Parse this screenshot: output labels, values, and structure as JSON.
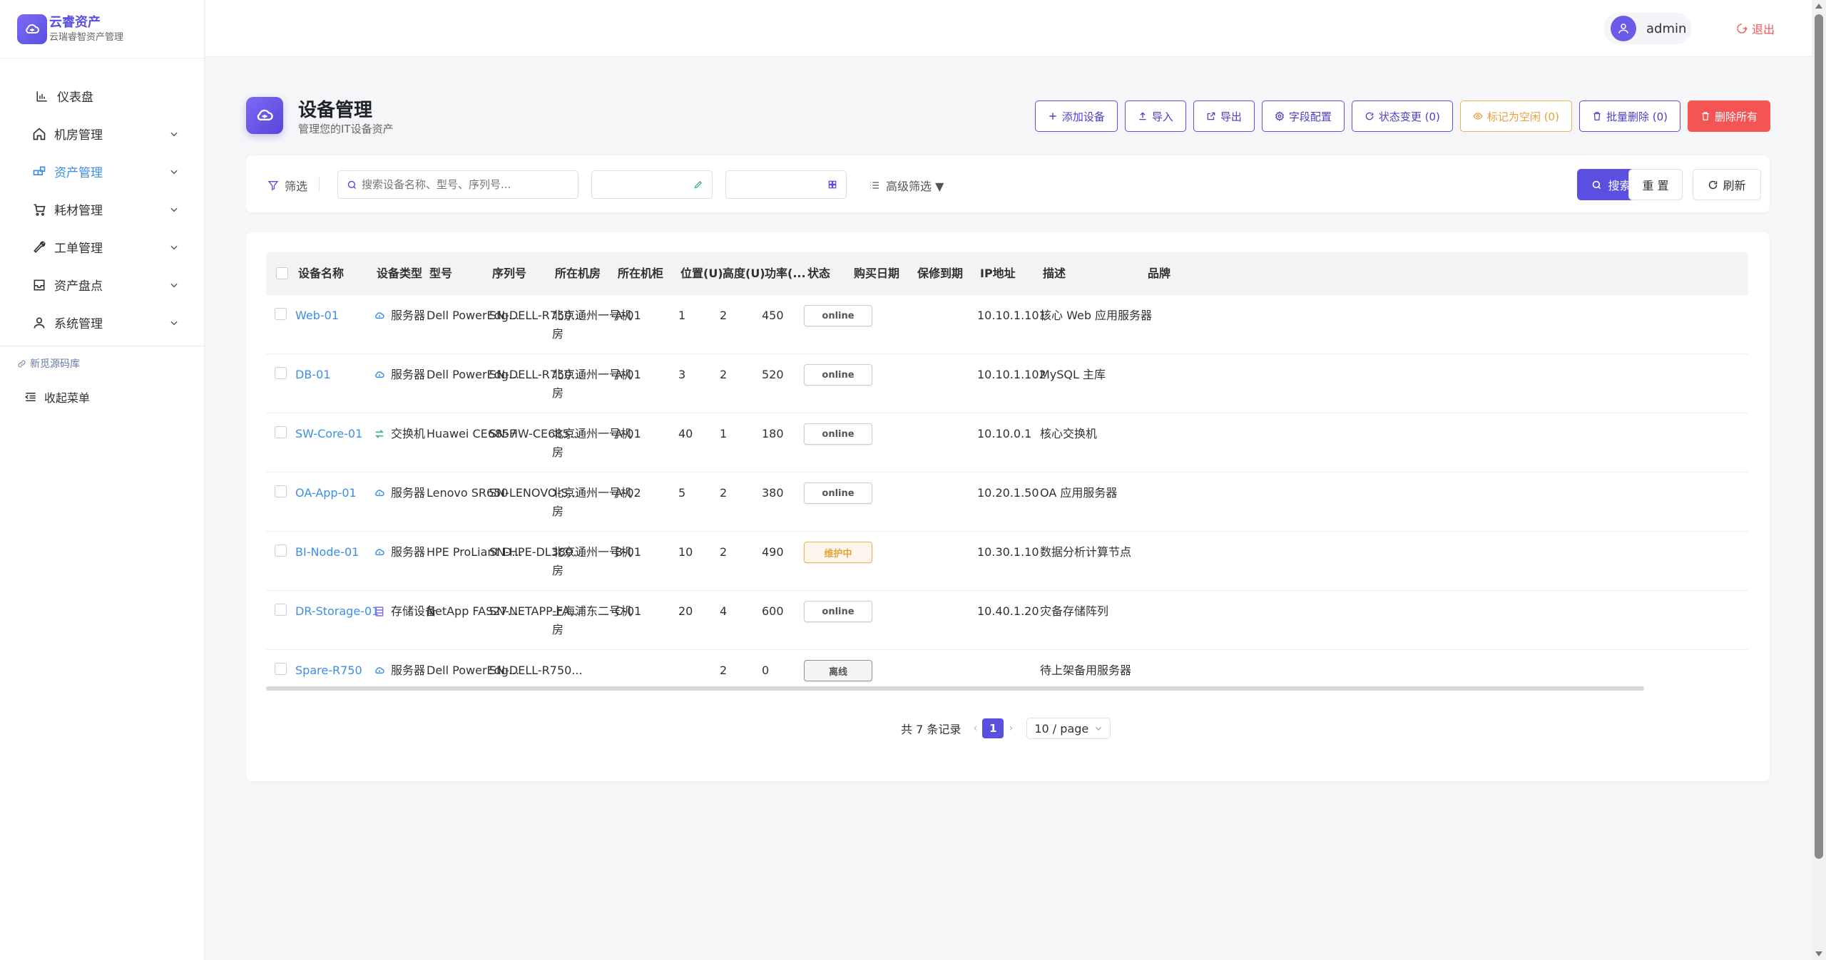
{
  "app": {
    "title": "云睿资产",
    "subtitle": "云瑞睿智资产管理"
  },
  "sidebar": {
    "items": [
      {
        "label": "仪表盘",
        "icon": "bar-chart-icon",
        "chevron": false,
        "active": false
      },
      {
        "label": "机房管理",
        "icon": "home-icon",
        "chevron": true,
        "active": false
      },
      {
        "label": "资产管理",
        "icon": "assets-icon",
        "chevron": true,
        "active": true
      },
      {
        "label": "耗材管理",
        "icon": "cart-icon",
        "chevron": true,
        "active": false
      },
      {
        "label": "工单管理",
        "icon": "wrench-icon",
        "chevron": true,
        "active": false
      },
      {
        "label": "资产盘点",
        "icon": "inbox-icon",
        "chevron": true,
        "active": false
      },
      {
        "label": "系统管理",
        "icon": "user-icon",
        "chevron": true,
        "active": false
      }
    ],
    "link_label": "新觅源码库",
    "collapse_label": "收起菜单"
  },
  "header": {
    "username": "admin",
    "logout_label": "退出"
  },
  "page": {
    "title": "设备管理",
    "subtitle": "管理您的IT设备资产"
  },
  "actions": {
    "add": "添加设备",
    "import": "导入",
    "export": "导出",
    "fields": "字段配置",
    "status_change": "状态变更 (0)",
    "mark_idle": "标记为空闲 (0)",
    "batch_delete": "批量删除 (0)",
    "delete_all": "删除所有"
  },
  "filter": {
    "label": "筛选",
    "search_placeholder": "搜索设备名称、型号、序列号...",
    "advanced": "高级筛选 ▼",
    "search_btn": "搜索",
    "reset_btn": "重 置",
    "refresh_btn": "刷新"
  },
  "table": {
    "columns": [
      "设备名称",
      "设备类型",
      "型号",
      "序列号",
      "所在机房",
      "所在机柜",
      "位置(U)",
      "高度(U)",
      "功率(...",
      "状态",
      "购买日期",
      "保修到期",
      "IP地址",
      "描述",
      "品牌"
    ],
    "rows": [
      {
        "name": "Web-01",
        "type": "服务器",
        "type_icon": "cloud-icon",
        "model": "Dell PowerEdg...",
        "serial": "SN-DELL-R750...",
        "room": "北京通州一号机房",
        "rack": "A-01",
        "pos": "1",
        "height": "2",
        "power": "450",
        "status": "online",
        "status_kind": "online",
        "buy": "",
        "warranty": "",
        "ip": "10.10.1.101",
        "desc": "核心 Web 应用服务器",
        "brand": ""
      },
      {
        "name": "DB-01",
        "type": "服务器",
        "type_icon": "cloud-icon",
        "model": "Dell PowerEdg...",
        "serial": "SN-DELL-R750...",
        "room": "北京通州一号机房",
        "rack": "A-01",
        "pos": "3",
        "height": "2",
        "power": "520",
        "status": "online",
        "status_kind": "online",
        "buy": "",
        "warranty": "",
        "ip": "10.10.1.102",
        "desc": "MySQL 主库",
        "brand": ""
      },
      {
        "name": "SW-Core-01",
        "type": "交换机",
        "type_icon": "switch-icon",
        "model": "Huawei CE6857",
        "serial": "SN-HW-CE685...",
        "room": "北京通州一号机房",
        "rack": "A-01",
        "pos": "40",
        "height": "1",
        "power": "180",
        "status": "online",
        "status_kind": "online",
        "buy": "",
        "warranty": "",
        "ip": "10.10.0.1",
        "desc": "核心交换机",
        "brand": ""
      },
      {
        "name": "OA-App-01",
        "type": "服务器",
        "type_icon": "cloud-icon",
        "model": "Lenovo SR650",
        "serial": "SN-LENOVO-S...",
        "room": "北京通州一号机房",
        "rack": "A-02",
        "pos": "5",
        "height": "2",
        "power": "380",
        "status": "online",
        "status_kind": "online",
        "buy": "",
        "warranty": "",
        "ip": "10.20.1.50",
        "desc": "OA 应用服务器",
        "brand": ""
      },
      {
        "name": "BI-Node-01",
        "type": "服务器",
        "type_icon": "cloud-icon",
        "model": "HPE ProLiant D...",
        "serial": "SN-HPE-DL380...",
        "room": "北京通州一号机房",
        "rack": "B-01",
        "pos": "10",
        "height": "2",
        "power": "490",
        "status": "维护中",
        "status_kind": "maint",
        "buy": "",
        "warranty": "",
        "ip": "10.30.1.10",
        "desc": "数据分析计算节点",
        "brand": ""
      },
      {
        "name": "DR-Storage-01",
        "type": "存储设备",
        "type_icon": "storage-icon",
        "model": "NetApp FAS27...",
        "serial": "SN-NETAPP-FA...",
        "room": "上海浦东二号机房",
        "rack": "C-01",
        "pos": "20",
        "height": "4",
        "power": "600",
        "status": "online",
        "status_kind": "online",
        "buy": "",
        "warranty": "",
        "ip": "10.40.1.20",
        "desc": "灾备存储阵列",
        "brand": ""
      },
      {
        "name": "Spare-R750",
        "type": "服务器",
        "type_icon": "cloud-icon",
        "model": "Dell PowerEdg...",
        "serial": "SN-DELL-R750...",
        "room": "",
        "rack": "",
        "pos": "",
        "height": "2",
        "power": "0",
        "status": "离线",
        "status_kind": "off",
        "buy": "",
        "warranty": "",
        "ip": "",
        "desc": "待上架备用服务器",
        "brand": ""
      }
    ]
  },
  "pagination": {
    "total": "共 7 条记录",
    "current": "1",
    "page_size": "10 / page"
  },
  "colors": {
    "accent": "#5a4fe0",
    "link": "#3a8ee6",
    "danger": "#f45454",
    "warning": "#e5a13a"
  }
}
